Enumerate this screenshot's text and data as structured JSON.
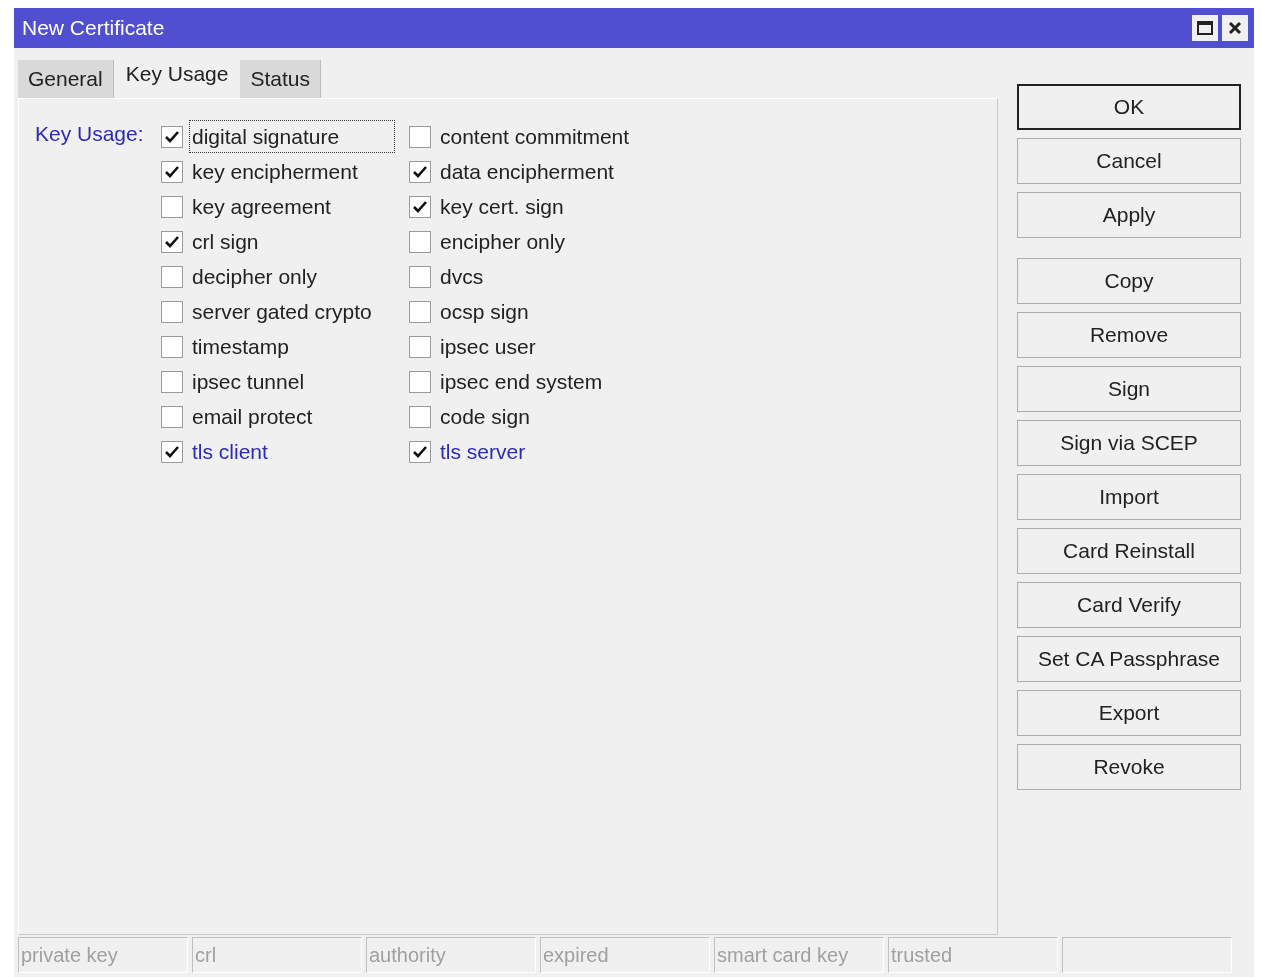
{
  "window": {
    "title": "New Certificate"
  },
  "tabs": [
    {
      "label": "General",
      "selected": false
    },
    {
      "label": "Key Usage",
      "selected": true
    },
    {
      "label": "Status",
      "selected": false
    }
  ],
  "key_usage": {
    "label": "Key Usage:",
    "columns": [
      [
        {
          "label": "digital signature",
          "checked": true,
          "focused": true,
          "highlighted": false
        },
        {
          "label": "key encipherment",
          "checked": true,
          "focused": false,
          "highlighted": false
        },
        {
          "label": "key agreement",
          "checked": false,
          "focused": false,
          "highlighted": false
        },
        {
          "label": "crl sign",
          "checked": true,
          "focused": false,
          "highlighted": false
        },
        {
          "label": "decipher only",
          "checked": false,
          "focused": false,
          "highlighted": false
        },
        {
          "label": "server gated crypto",
          "checked": false,
          "focused": false,
          "highlighted": false
        },
        {
          "label": "timestamp",
          "checked": false,
          "focused": false,
          "highlighted": false
        },
        {
          "label": "ipsec tunnel",
          "checked": false,
          "focused": false,
          "highlighted": false
        },
        {
          "label": "email protect",
          "checked": false,
          "focused": false,
          "highlighted": false
        },
        {
          "label": "tls client",
          "checked": true,
          "focused": false,
          "highlighted": true
        }
      ],
      [
        {
          "label": "content commitment",
          "checked": false,
          "focused": false,
          "highlighted": false
        },
        {
          "label": "data encipherment",
          "checked": true,
          "focused": false,
          "highlighted": false
        },
        {
          "label": "key cert. sign",
          "checked": true,
          "focused": false,
          "highlighted": false
        },
        {
          "label": "encipher only",
          "checked": false,
          "focused": false,
          "highlighted": false
        },
        {
          "label": "dvcs",
          "checked": false,
          "focused": false,
          "highlighted": false
        },
        {
          "label": "ocsp sign",
          "checked": false,
          "focused": false,
          "highlighted": false
        },
        {
          "label": "ipsec user",
          "checked": false,
          "focused": false,
          "highlighted": false
        },
        {
          "label": "ipsec end system",
          "checked": false,
          "focused": false,
          "highlighted": false
        },
        {
          "label": "code sign",
          "checked": false,
          "focused": false,
          "highlighted": false
        },
        {
          "label": "tls server",
          "checked": true,
          "focused": false,
          "highlighted": true
        }
      ]
    ]
  },
  "button_groups": [
    [
      {
        "label": "OK",
        "default": true
      },
      {
        "label": "Cancel",
        "default": false
      },
      {
        "label": "Apply",
        "default": false
      }
    ],
    [
      {
        "label": "Copy",
        "default": false
      },
      {
        "label": "Remove",
        "default": false
      },
      {
        "label": "Sign",
        "default": false
      },
      {
        "label": "Sign via SCEP",
        "default": false
      },
      {
        "label": "Import",
        "default": false
      },
      {
        "label": "Card Reinstall",
        "default": false
      },
      {
        "label": "Card Verify",
        "default": false
      },
      {
        "label": "Set CA Passphrase",
        "default": false
      },
      {
        "label": "Export",
        "default": false
      },
      {
        "label": "Revoke",
        "default": false
      }
    ]
  ],
  "status_bar": [
    "private key",
    "crl",
    "authority",
    "expired",
    "smart card key",
    "trusted"
  ]
}
